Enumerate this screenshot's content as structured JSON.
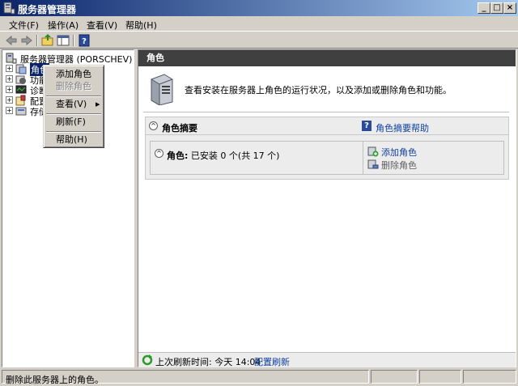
{
  "window": {
    "title": "服务器管理器",
    "buttons": {
      "minimize": "_",
      "maximize": "□",
      "close": "×"
    }
  },
  "menu": [
    "文件(F)",
    "操作(A)",
    "查看(V)",
    "帮助(H)"
  ],
  "toolbar": {
    "icons": [
      "back-arrow-icon",
      "forward-arrow-icon",
      "up-folder-icon",
      "show-hide-tree-icon",
      "help-icon"
    ]
  },
  "tree": {
    "root": "服务器管理器 (PORSCHEV)",
    "nodes": [
      {
        "label": "角色",
        "icon": "roles-icon",
        "selected": true
      },
      {
        "label": "功能",
        "icon": "features-icon"
      },
      {
        "label": "诊断",
        "icon": "diagnostics-icon"
      },
      {
        "label": "配置",
        "icon": "configuration-icon"
      },
      {
        "label": "存储",
        "icon": "storage-icon"
      }
    ]
  },
  "context_menu": {
    "items": [
      {
        "label": "添加角色",
        "enabled": true
      },
      {
        "label": "删除角色",
        "enabled": false
      },
      {
        "label": "查看(V)",
        "submenu": true
      },
      {
        "label": "刷新(F)"
      },
      {
        "label": "帮助(H)"
      }
    ],
    "submenu_arrow": "▸"
  },
  "main": {
    "header": "角色",
    "intro": "查看安装在服务器上角色的运行状况，以及添加或删除角色和功能。",
    "summary": {
      "title": "角色摘要",
      "help_link": "角色摘要帮助",
      "help_glyph": "?",
      "collapse_glyph": "^",
      "roles_label": "角色:",
      "roles_status": "已安装 0 个(共 17 个)",
      "add_role": "添加角色",
      "remove_role": "删除角色"
    },
    "footer": {
      "last_refresh": "上次刷新时间: 今天 14:04",
      "configure_refresh": "配置刷新"
    }
  },
  "statusbar": {
    "text": "删除此服务器上的角色。"
  },
  "colors": {
    "titlebar_start": "#0a246a",
    "titlebar_end": "#a6caf0",
    "pane_header": "#404040",
    "link": "#1040a0"
  }
}
